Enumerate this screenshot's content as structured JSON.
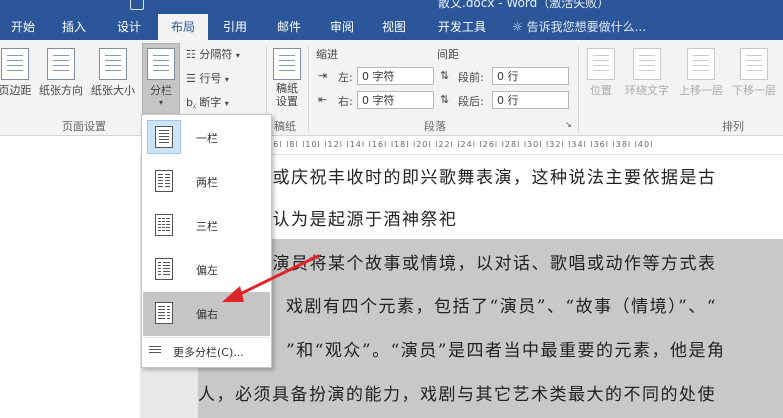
{
  "window": {
    "title": "散文.docx - Word（激活失败）"
  },
  "tabs": [
    {
      "label": "开始",
      "active": false
    },
    {
      "label": "插入",
      "active": false
    },
    {
      "label": "设计",
      "active": false
    },
    {
      "label": "布局",
      "active": true
    },
    {
      "label": "引用",
      "active": false
    },
    {
      "label": "邮件",
      "active": false
    },
    {
      "label": "审阅",
      "active": false
    },
    {
      "label": "视图",
      "active": false
    },
    {
      "label": "开发工具",
      "active": false
    }
  ],
  "tell_me": "告诉我您想要做什么...",
  "ribbon": {
    "page_setup": {
      "margins": "页边距",
      "orientation": "纸张方向",
      "size": "纸张大小",
      "columns": "分栏",
      "breaks": "分隔符",
      "line_numbers": "行号",
      "hyphenation": "断字",
      "group": "页面设置"
    },
    "draft": {
      "button": "稿纸设置",
      "group": "稿纸"
    },
    "paragraph": {
      "indent_header": "缩进",
      "spacing_header": "间距",
      "left_label": "左:",
      "left_value": "0 字符",
      "right_label": "右:",
      "right_value": "0 字符",
      "before_label": "段前:",
      "before_value": "0 行",
      "after_label": "段后:",
      "after_value": "0 行",
      "group": "段落"
    },
    "arrange": {
      "position": "位置",
      "wrap_text": "环绕文字",
      "bring_forward": "上移一层",
      "send_backward": "下移一层",
      "group": "排列"
    }
  },
  "ruler_text": "l6l  l8l  l10l  l12l  l14l  l16l  l18l  l20l  l22l  l24l  l26l  l28l  l30l  l32l  l34l  l36l  l38l  l40l",
  "columns_menu": {
    "items": [
      {
        "label": "一栏",
        "checked": true
      },
      {
        "label": "两栏",
        "checked": false
      },
      {
        "label": "三栏",
        "checked": false
      },
      {
        "label": "偏左",
        "checked": false
      },
      {
        "label": "偏右",
        "checked": false
      }
    ],
    "more": "更多分栏(C)..."
  },
  "document": {
    "lines": [
      "动或庆祝丰收时的即兴歌舞表演，这种说法主要依据是古",
      "被认为是起源于酒神祭祀",
      "由演员将某个故事或情境，以对话、歌唱或动作等方式表",
      "戏剧有四个元素，包括了“演员”、“故事（情境）”、“",
      "”和“观众”。“演员”是四者当中最重要的元素，他是角",
      "人，必须具备扮演的能力，戏剧与其它艺术类最大的不同的处使"
    ]
  },
  "annotation": {
    "arrow_color": "#e0242b"
  }
}
